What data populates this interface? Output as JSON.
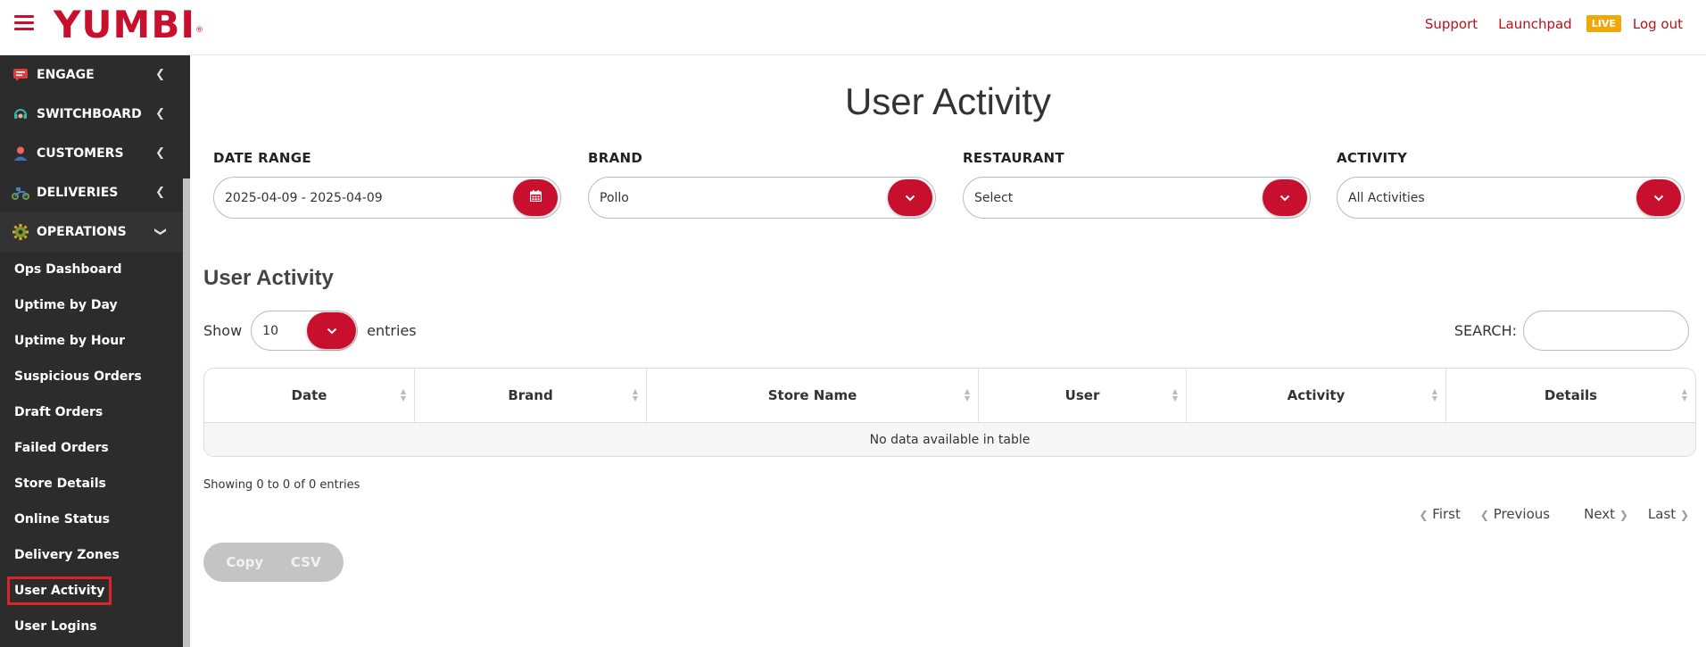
{
  "brand": {
    "logo": "YUMBI",
    "registered": "®",
    "accent": "#c8102e"
  },
  "top_links": {
    "support": "Support",
    "launchpad": "Launchpad",
    "live": "LIVE",
    "logout": "Log out"
  },
  "sidebar": {
    "sections": [
      {
        "label": "ENGAGE",
        "icon": "chat-icon"
      },
      {
        "label": "SWITCHBOARD",
        "icon": "headset-icon"
      },
      {
        "label": "CUSTOMERS",
        "icon": "user-icon"
      },
      {
        "label": "DELIVERIES",
        "icon": "scooter-icon"
      },
      {
        "label": "OPERATIONS",
        "icon": "gear-icon"
      }
    ],
    "operations_items": [
      "Ops Dashboard",
      "Uptime by Day",
      "Uptime by Hour",
      "Suspicious Orders",
      "Draft Orders",
      "Failed Orders",
      "Store Details",
      "Online Status",
      "Delivery Zones",
      "User Activity",
      "User Logins"
    ],
    "active_item": "User Activity"
  },
  "page": {
    "title": "User Activity"
  },
  "filters": {
    "date_range": {
      "label": "DATE RANGE",
      "value": "2025-04-09 - 2025-04-09"
    },
    "brand": {
      "label": "BRAND",
      "value": "Pollo"
    },
    "restaurant": {
      "label": "RESTAURANT",
      "value": "Select"
    },
    "activity": {
      "label": "ACTIVITY",
      "value": "All Activities"
    }
  },
  "table_section": {
    "title": "User Activity",
    "show_label": "Show",
    "page_length": "10",
    "entries_label": "entries",
    "search_label": "SEARCH:",
    "search_value": "",
    "columns": [
      "Date",
      "Brand",
      "Store Name",
      "User",
      "Activity",
      "Details"
    ],
    "empty_message": "No data available in table",
    "info": "Showing 0 to 0 of 0 entries"
  },
  "pagination": {
    "first": "First",
    "previous": "Previous",
    "next": "Next",
    "last": "Last"
  },
  "export": {
    "copy": "Copy",
    "csv": "CSV"
  }
}
